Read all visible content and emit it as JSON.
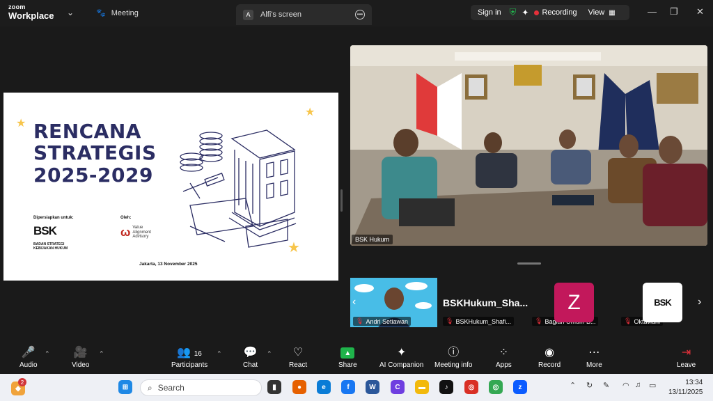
{
  "app": {
    "brand_top": "zoom",
    "brand_bottom": "Workplace",
    "meeting_label": "Meeting"
  },
  "share_tab": {
    "avatar_letter": "A",
    "label": "Alfi's screen"
  },
  "top_right": {
    "sign_in": "Sign in",
    "recording": "Recording",
    "view": "View"
  },
  "slide": {
    "title_line1": "RENCANA",
    "title_line2": "STRATEGIS",
    "title_line3": "2025-2029",
    "prepared_for": "Dipersiapkan untuk:",
    "bsk_logo": "BSK",
    "bsk_sub1": "BADAN STRATEGI",
    "bsk_sub2": "KEBIJAKAN HUKUM",
    "by": "Oleh:",
    "va_line1": "Value",
    "va_line2": "Alignment",
    "va_line3": "Advisory",
    "date": "Jakarta, 13 November 2025"
  },
  "main_video": {
    "name": "BSK Hukum"
  },
  "thumbnails": [
    {
      "name": "Andri Setiawan"
    },
    {
      "name": "BSKHukum_Shafi...",
      "big_name": "BSKHukum_Sha..."
    },
    {
      "name": "Bagian Umum B...",
      "avatar": "Z"
    },
    {
      "name": "Oktaviani",
      "avatar": "BSK"
    }
  ],
  "toolbar": {
    "audio": "Audio",
    "video": "Video",
    "participants": "Participants",
    "participants_count": "16",
    "chat": "Chat",
    "react": "React",
    "share": "Share",
    "ai": "AI Companion",
    "info": "Meeting info",
    "apps": "Apps",
    "record": "Record",
    "more": "More",
    "leave": "Leave"
  },
  "taskbar": {
    "search_placeholder": "Search",
    "notif_count": "2",
    "time": "13:34",
    "date": "13/11/2025"
  }
}
